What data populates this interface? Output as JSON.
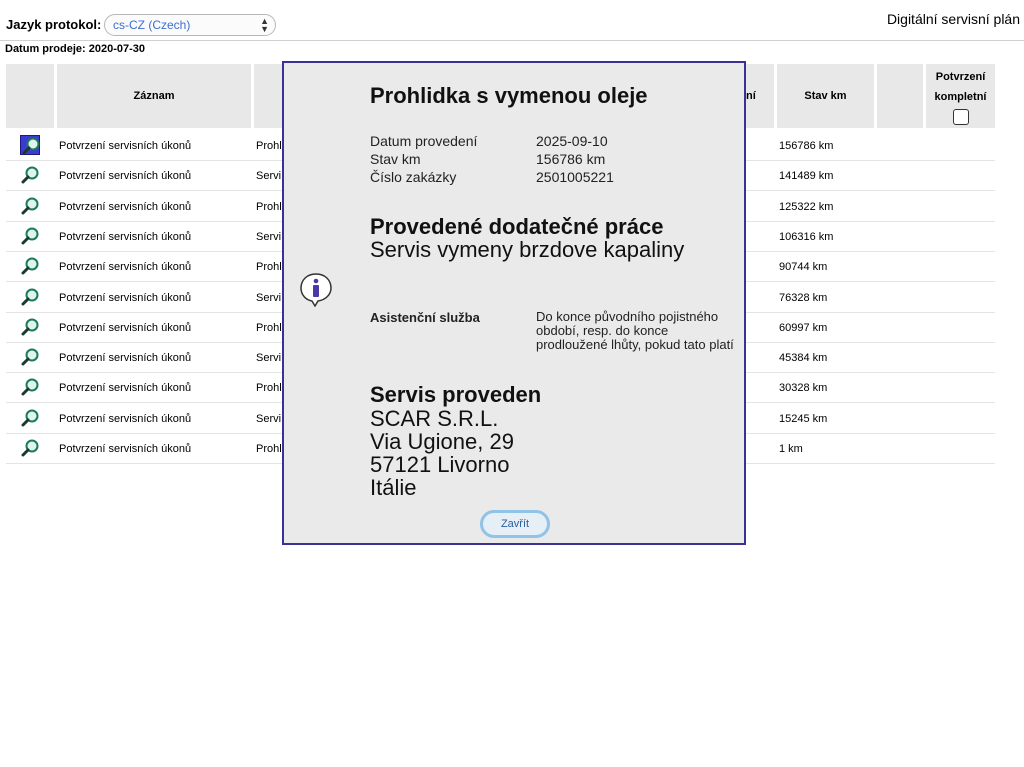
{
  "header": {
    "language_label": "Jazyk protokol:",
    "language_value": "cs-CZ (Czech)",
    "app_title": "Digitální servisní plán",
    "sale_date": "Datum prodeje: 2020-07-30"
  },
  "table": {
    "columns": {
      "record": "Záznam",
      "km_suffix": "ní",
      "km": "Stav km",
      "confirmed_line1": "Potvrzení",
      "confirmed_line2": "kompletní"
    },
    "rows": [
      {
        "record": "Potvrzení servisních úkonů",
        "type": "Prohl",
        "km": "156786 km"
      },
      {
        "record": "Potvrzení servisních úkonů",
        "type": "Servi",
        "km": "141489 km"
      },
      {
        "record": "Potvrzení servisních úkonů",
        "type": "Prohl",
        "km": "125322 km"
      },
      {
        "record": "Potvrzení servisních úkonů",
        "type": "Servi",
        "km": "106316 km"
      },
      {
        "record": "Potvrzení servisních úkonů",
        "type": "Prohl",
        "km": "90744 km"
      },
      {
        "record": "Potvrzení servisních úkonů",
        "type": "Servi",
        "km": "76328 km"
      },
      {
        "record": "Potvrzení servisních úkonů",
        "type": "Prohl",
        "km": "60997 km"
      },
      {
        "record": "Potvrzení servisních úkonů",
        "type": "Servi",
        "km": "45384 km"
      },
      {
        "record": "Potvrzení servisních úkonů",
        "type": "Prohl",
        "km": "30328 km"
      },
      {
        "record": "Potvrzení servisních úkonů",
        "type": "Servi",
        "km": "15245 km"
      },
      {
        "record": "Potvrzení servisních úkonů",
        "type": "Prohl",
        "km": "1 km"
      }
    ]
  },
  "dialog": {
    "title": "Prohlidka s vymenou oleje",
    "fields": [
      {
        "label": "Datum provedení",
        "value": "2025-09-10"
      },
      {
        "label": "Stav km",
        "value": "156786 km"
      },
      {
        "label": "Číslo zakázky",
        "value": "2501005221"
      }
    ],
    "additional_title": "Provedené dodatečné práce",
    "additional_text": "Servis vymeny brzdove kapaliny",
    "assistance_label": "Asistenční služba",
    "assistance_text": "Do konce původního pojistného období, resp. do konce prodloužené lhůty, pokud tato platí",
    "performed_title": "Servis proveden",
    "performed_by": "SCAR S.R.L.",
    "address_street": "Via Ugione, 29",
    "address_city": "57121 Livorno",
    "address_country": "Itálie",
    "close_label": "Zavřít"
  }
}
